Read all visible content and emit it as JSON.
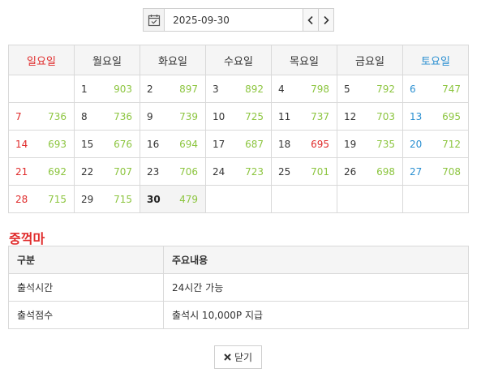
{
  "date_picker": {
    "value": "2025-09-30",
    "calendar_icon": "calendar-check-icon",
    "prev_icon": "chevron-left-icon",
    "next_icon": "chevron-right-icon"
  },
  "calendar": {
    "weekdays": [
      "일요일",
      "월요일",
      "화요일",
      "수요일",
      "목요일",
      "금요일",
      "토요일"
    ],
    "weeks": [
      [
        null,
        {
          "day": "1",
          "count": "903"
        },
        {
          "day": "2",
          "count": "897"
        },
        {
          "day": "3",
          "count": "892"
        },
        {
          "day": "4",
          "count": "798"
        },
        {
          "day": "5",
          "count": "792"
        },
        {
          "day": "6",
          "count": "747"
        }
      ],
      [
        {
          "day": "7",
          "count": "736"
        },
        {
          "day": "8",
          "count": "736"
        },
        {
          "day": "9",
          "count": "739"
        },
        {
          "day": "10",
          "count": "725"
        },
        {
          "day": "11",
          "count": "737"
        },
        {
          "day": "12",
          "count": "703"
        },
        {
          "day": "13",
          "count": "695"
        }
      ],
      [
        {
          "day": "14",
          "count": "693"
        },
        {
          "day": "15",
          "count": "676"
        },
        {
          "day": "16",
          "count": "694"
        },
        {
          "day": "17",
          "count": "687"
        },
        {
          "day": "18",
          "count": "695",
          "highlight": true
        },
        {
          "day": "19",
          "count": "735"
        },
        {
          "day": "20",
          "count": "712"
        }
      ],
      [
        {
          "day": "21",
          "count": "692"
        },
        {
          "day": "22",
          "count": "707"
        },
        {
          "day": "23",
          "count": "706"
        },
        {
          "day": "24",
          "count": "723"
        },
        {
          "day": "25",
          "count": "701"
        },
        {
          "day": "26",
          "count": "698"
        },
        {
          "day": "27",
          "count": "708"
        }
      ],
      [
        {
          "day": "28",
          "count": "715"
        },
        {
          "day": "29",
          "count": "715"
        },
        {
          "day": "30",
          "count": "479",
          "today": true
        },
        null,
        null,
        null,
        null
      ]
    ]
  },
  "section_title": "중꺽마",
  "info": {
    "headers": [
      "구분",
      "주요내용"
    ],
    "rows": [
      [
        "출석시간",
        "24시간 가능"
      ],
      [
        "출석점수",
        "출석시 10,000P 지급"
      ]
    ]
  },
  "close_button": {
    "label": "닫기",
    "icon": "close-x-icon"
  },
  "colors": {
    "sunday": "#e02b2b",
    "saturday": "#2a8fd1",
    "count": "#8cc53f"
  }
}
